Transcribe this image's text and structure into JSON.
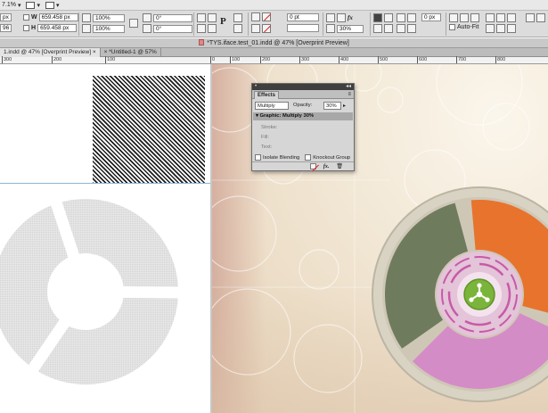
{
  "menubar": {
    "zoom": "7.1%",
    "zoom_arrow": "▾",
    "view_arrow": "▾",
    "screen_arrow": "▾"
  },
  "control": {
    "w_label": "W",
    "h_label": "H",
    "w_value": "659.458 px",
    "h_value": "659.458 px",
    "x_partial": "px",
    "y_partial": "96 px",
    "scale_x": "100%",
    "scale_y": "100%",
    "angle": "0°",
    "shear": "0°",
    "stroke_weight": "0 pt",
    "fit_width": "0 px",
    "opacity": "30%",
    "auto_fit_label": "Auto-Fit",
    "p_glyph": "P"
  },
  "title": {
    "text": "*TYS.iface.test_01.indd @ 47% [Overprint Preview]"
  },
  "tabs": [
    {
      "label": "1.indd @ 47% [Overprint Preview]",
      "close": "×"
    },
    {
      "label": "*Untitled-1 @ 57%",
      "close": "×"
    }
  ],
  "ruler": {
    "ticks": [
      "300",
      "200",
      "100",
      "0",
      "100",
      "200",
      "300",
      "400",
      "500",
      "600",
      "700",
      "800"
    ]
  },
  "effects": {
    "panel_title": "Effects",
    "menu_glyph": "≡",
    "close_glyph": "◂◂",
    "blend_mode": "Multiply",
    "opacity_label": "Opacity:",
    "opacity_value": "30%",
    "opacity_arrow": "▸",
    "selected_row": "Graphic: Multiply 30%",
    "items": [
      "Stroke:",
      "Fill:",
      "Text:"
    ],
    "isolate_label": "Isolate Blending",
    "knockout_label": "Knockout Group",
    "fx_label": "fx.",
    "trash_glyph": "🗑"
  },
  "colors": {
    "orange": "#e8732c",
    "green": "#6f7b5d",
    "pink": "#d48cc6",
    "lime": "#7ab43a",
    "ring": "#d9d3c4"
  }
}
